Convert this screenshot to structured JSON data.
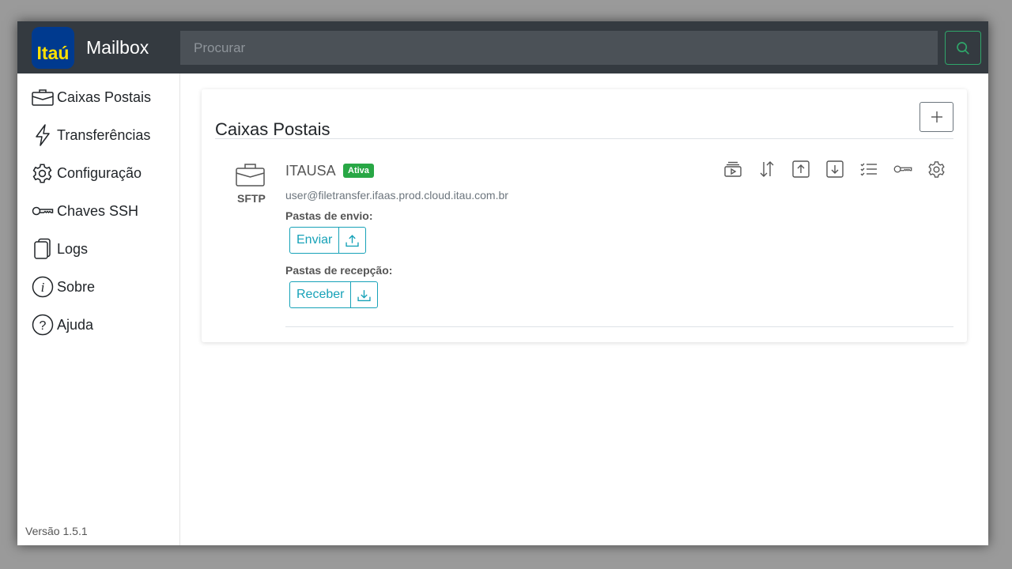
{
  "app": {
    "logo_text": "Itaú",
    "title": "Mailbox",
    "brand_color": "#003a8f",
    "logo_text_color": "#ffe000"
  },
  "search": {
    "placeholder": "Procurar",
    "value": ""
  },
  "sidebar": {
    "items": [
      {
        "label": "Caixas Postais",
        "icon": "briefcase-icon"
      },
      {
        "label": "Transferências",
        "icon": "lightning-icon"
      },
      {
        "label": "Configuração",
        "icon": "gear-icon"
      },
      {
        "label": "Chaves SSH",
        "icon": "key-icon"
      },
      {
        "label": "Logs",
        "icon": "files-icon"
      },
      {
        "label": "Sobre",
        "icon": "info-icon"
      },
      {
        "label": "Ajuda",
        "icon": "question-icon"
      }
    ],
    "version": "Versão 1.5.1"
  },
  "main": {
    "title": "Caixas Postais",
    "mailbox": {
      "name": "ITAUSA",
      "status": "Ativa",
      "status_color": "#28a745",
      "protocol": "SFTP",
      "host": "user@filetransfer.ifaas.prod.cloud.itau.com.br",
      "send_label": "Pastas de envio:",
      "send_button": "Enviar",
      "receive_label": "Pastas de recepção:",
      "receive_button": "Receber",
      "actions": [
        "collection-play-icon",
        "transfer-arrows-icon",
        "upload-box-icon",
        "download-box-icon",
        "checklist-icon",
        "key-icon",
        "gear-icon"
      ]
    }
  },
  "colors": {
    "accent": "#17a2b8",
    "topbar": "#343a40",
    "search_btn": "#2fa66a"
  }
}
